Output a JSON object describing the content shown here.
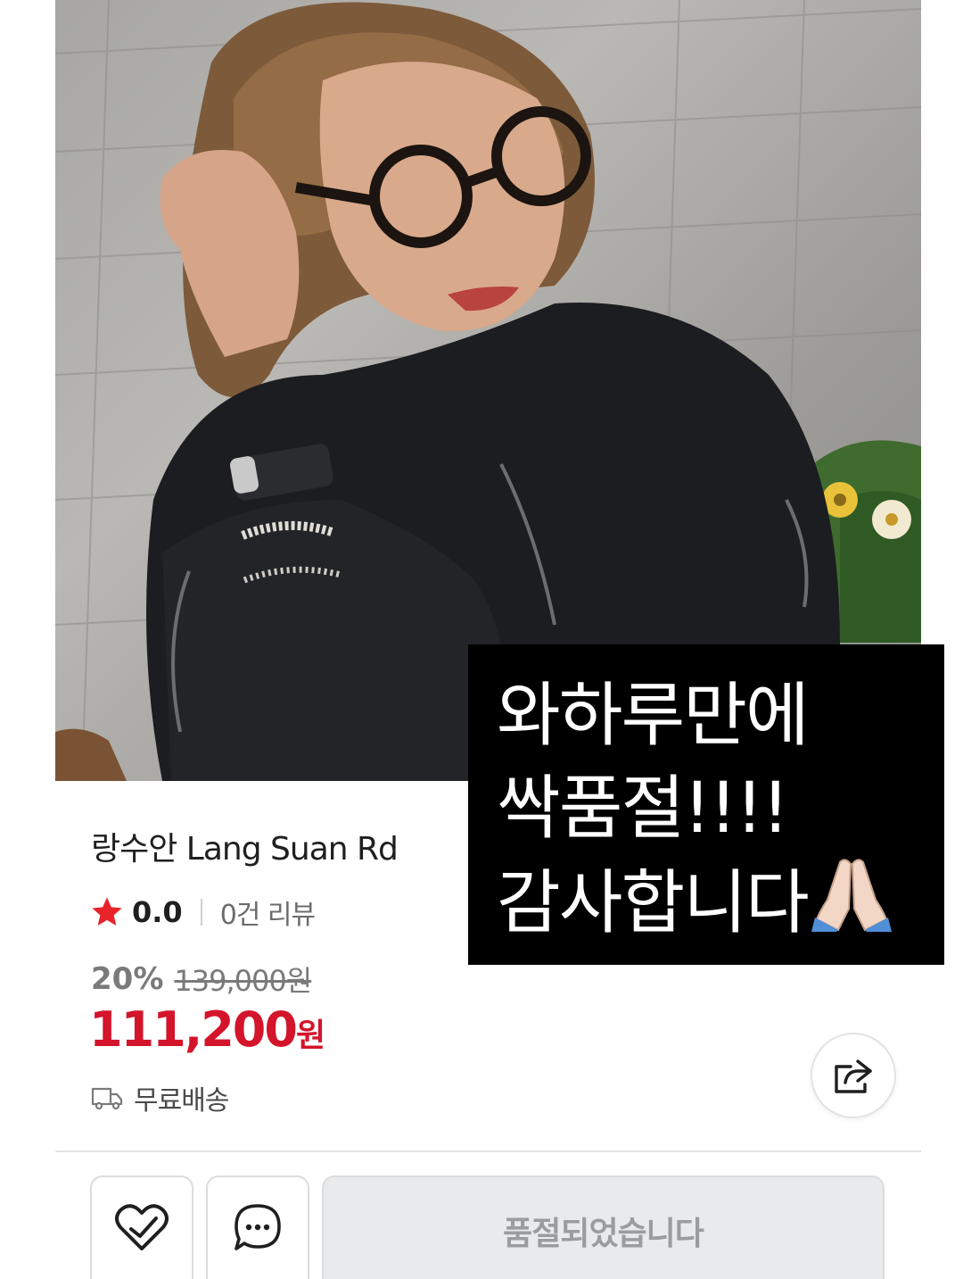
{
  "product": {
    "image_alt": "Woman with short brown hair wearing round black glasses and a black jacket, adjusting her hair, seated on a paved plaza near yellow flowers",
    "title": "랑수안 Lang Suan Rd",
    "rating": "0.0",
    "review_count": "0건 리뷰",
    "discount": "20%",
    "original_price": "139,000원",
    "price": "111,200",
    "price_unit": "원",
    "shipping": "무료배송"
  },
  "overlay": {
    "lines": [
      "와하루만에",
      "싹품절!!!!",
      "감사합니다"
    ],
    "emoji": "folded-hands-emoji"
  },
  "actions": {
    "like_icon": "heart-check-icon",
    "chat_icon": "chat-bubble-icon",
    "share_icon": "share-icon",
    "soldout_label": "품절되었습니다"
  },
  "colors": {
    "price_red": "#d4142a",
    "star_red": "#e8232a",
    "soldout_bg": "#e9eaec",
    "soldout_text": "#9a9ca0"
  }
}
